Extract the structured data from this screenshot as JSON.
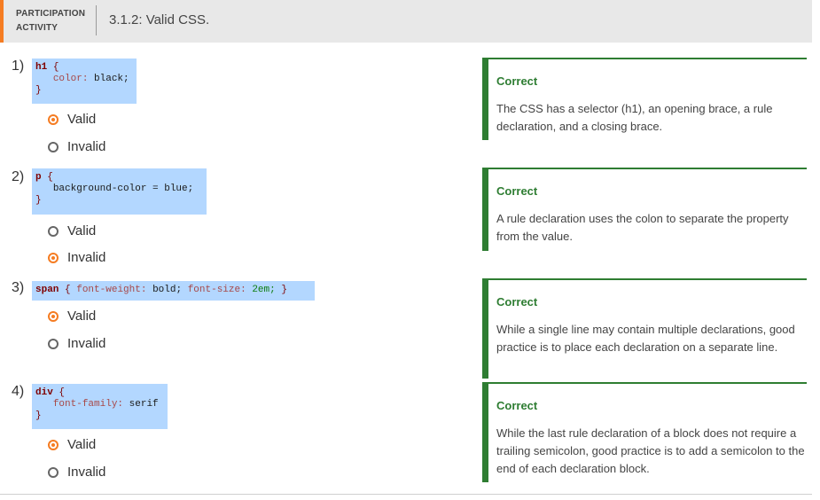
{
  "header": {
    "label_line1": "PARTICIPATION",
    "label_line2": "ACTIVITY",
    "title": "3.1.2: Valid CSS."
  },
  "colors": {
    "accent": "#f57c22",
    "correct": "#2e7d32",
    "code_bg": "#b3d7ff"
  },
  "questions": [
    {
      "number": "1)",
      "code": {
        "selector": "h1",
        "open": "{",
        "property": "color:",
        "value": "black;",
        "close": "}"
      },
      "options": [
        "Valid",
        "Invalid"
      ],
      "selected": "Valid",
      "feedback_title": "Correct",
      "feedback_text": "The CSS has a selector (h1), an opening brace, a rule declaration, and a closing brace."
    },
    {
      "number": "2)",
      "code": {
        "selector": "p",
        "open": "{",
        "property": "background-color = blue;",
        "close": "}"
      },
      "options": [
        "Valid",
        "Invalid"
      ],
      "selected": "Invalid",
      "feedback_title": "Correct",
      "feedback_text": "A rule declaration uses the colon to separate the property from the value."
    },
    {
      "number": "3)",
      "code": {
        "selector": "span",
        "open": "{",
        "property1": "font-weight:",
        "value1": "bold;",
        "property2": "font-size:",
        "value2": "2em;",
        "close": "}"
      },
      "options": [
        "Valid",
        "Invalid"
      ],
      "selected": "Valid",
      "feedback_title": "Correct",
      "feedback_text": "While a single line may contain multiple declarations, good practice is to place each declaration on a separate line."
    },
    {
      "number": "4)",
      "code": {
        "selector": "div",
        "open": "{",
        "property": "font-family:",
        "value": "serif",
        "close": "}"
      },
      "options": [
        "Valid",
        "Invalid"
      ],
      "selected": "Valid",
      "feedback_title": "Correct",
      "feedback_text": "While the last rule declaration of a block does not require a trailing semicolon, good practice is to add a semicolon to the end of each declaration block."
    }
  ]
}
